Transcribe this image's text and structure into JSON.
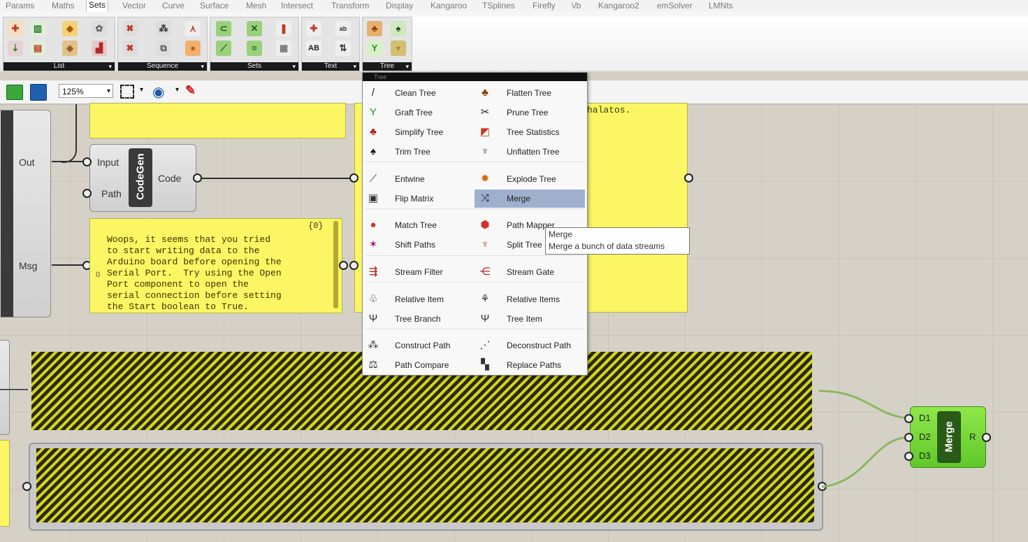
{
  "tabs": [
    "Params",
    "Maths",
    "Sets",
    "Vector",
    "Curve",
    "Surface",
    "Mesh",
    "Intersect",
    "Transform",
    "Display",
    "Kangaroo",
    "TSplines",
    "Firefly",
    "\\/b",
    "Kangaroo2",
    "emSolver",
    "LMNts"
  ],
  "active_tab": "Sets",
  "ribbon_groups": [
    "List",
    "Sequence",
    "Sets",
    "Text",
    "Tree"
  ],
  "toolbar": {
    "zoom": "125%"
  },
  "canvas": {
    "firefly_out_label": "Out",
    "firefly_msg_label": "Msg",
    "codegen": {
      "title": "CodeGen",
      "input": "Input",
      "path": "Path",
      "output": "Code"
    },
    "panel_counter": "{0}",
    "panel_index": "0",
    "panel_text": "Woops, it seems that you tried\nto start writing data to the\nArduino board before opening the\nSerial Port.  Try using the Open\nPort component to open the\nserial connection before setting\nthe Start boolean to True.",
    "right_panel_text": "halatos.",
    "merge": {
      "title": "Merge",
      "inputs": [
        "D1",
        "D2",
        "D3"
      ],
      "output": "R"
    }
  },
  "menu": {
    "title": "Tree",
    "items": [
      {
        "label": "Clean Tree",
        "icon": "broom-icon"
      },
      {
        "label": "Flatten Tree",
        "icon": "flatten-tree-icon"
      },
      {
        "label": "Graft Tree",
        "icon": "graft-tree-icon"
      },
      {
        "label": "Prune Tree",
        "icon": "prune-tree-icon"
      },
      {
        "label": "Simplify Tree",
        "icon": "simplify-tree-icon"
      },
      {
        "label": "Tree Statistics",
        "icon": "tree-statistics-icon"
      },
      {
        "label": "Trim Tree",
        "icon": "trim-tree-icon"
      },
      {
        "label": "Unflatten Tree",
        "icon": "unflatten-tree-icon"
      },
      {
        "label": "Entwine",
        "icon": "entwine-icon"
      },
      {
        "label": "Explode Tree",
        "icon": "explode-tree-icon"
      },
      {
        "label": "Flip Matrix",
        "icon": "flip-matrix-icon"
      },
      {
        "label": "Merge",
        "icon": "merge-icon"
      },
      {
        "label": "Match Tree",
        "icon": "match-tree-icon"
      },
      {
        "label": "Path Mapper",
        "icon": "path-mapper-icon"
      },
      {
        "label": "Shift Paths",
        "icon": "shift-paths-icon"
      },
      {
        "label": "Split Tree",
        "icon": "split-tree-icon"
      },
      {
        "label": "Stream Filter",
        "icon": "stream-filter-icon"
      },
      {
        "label": "Stream Gate",
        "icon": "stream-gate-icon"
      },
      {
        "label": "Relative Item",
        "icon": "relative-item-icon"
      },
      {
        "label": "Relative Items",
        "icon": "relative-items-icon"
      },
      {
        "label": "Tree Branch",
        "icon": "tree-branch-icon"
      },
      {
        "label": "Tree Item",
        "icon": "tree-item-icon"
      },
      {
        "label": "Construct Path",
        "icon": "construct-path-icon"
      },
      {
        "label": "Deconstruct Path",
        "icon": "deconstruct-path-icon"
      },
      {
        "label": "Path Compare",
        "icon": "path-compare-icon"
      },
      {
        "label": "Replace Paths",
        "icon": "replace-paths-icon"
      }
    ],
    "highlighted": "Merge"
  },
  "tooltip": {
    "title": "Merge",
    "description": "Merge a bunch of data streams"
  },
  "colors": {
    "panel_yellow": "#fcf664",
    "merge_green": "#6fd536",
    "menu_highlight": "#9fb0cf"
  }
}
